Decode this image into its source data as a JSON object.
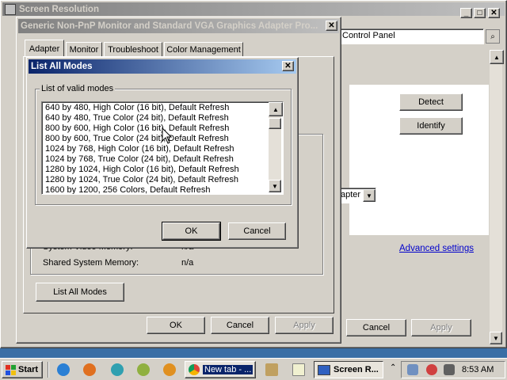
{
  "bg_window": {
    "title": "Screen Resolution",
    "address": "Control Panel",
    "detect_label": "Detect",
    "identify_label": "Identify",
    "dropdown_text": "apter",
    "advanced_link": "Advanced settings",
    "cancel_label": "Cancel",
    "apply_label": "Apply"
  },
  "props_dialog": {
    "title": "Generic Non-PnP Monitor and Standard VGA Graphics Adapter Pro...",
    "tabs": [
      "Adapter",
      "Monitor",
      "Troubleshoot",
      "Color Management"
    ],
    "info_rows": [
      {
        "label": "System Video Memory:",
        "value": "n/a"
      },
      {
        "label": "Shared System Memory:",
        "value": "n/a"
      }
    ],
    "list_all_modes_label": "List All Modes",
    "ok_label": "OK",
    "cancel_label": "Cancel",
    "apply_label": "Apply"
  },
  "modes_dialog": {
    "title": "List All Modes",
    "group_label": "List of valid modes",
    "modes": [
      "640 by 480, High Color (16 bit), Default Refresh",
      "640 by 480, True Color (24 bit), Default Refresh",
      "800 by 600, High Color (16 bit), Default Refresh",
      "800 by 600, True Color (24 bit), Default Refresh",
      "1024 by 768, High Color (16 bit), Default Refresh",
      "1024 by 768, True Color (24 bit), Default Refresh",
      "1280 by 1024, High Color (16 bit), Default Refresh",
      "1280 by 1024, True Color (24 bit), Default Refresh",
      "1600 by 1200, 256 Colors, Default Refresh"
    ],
    "ok_label": "OK",
    "cancel_label": "Cancel"
  },
  "taskbar": {
    "start_label": "Start",
    "tasks": [
      {
        "label": "New tab - ...",
        "icon": "chrome-icon"
      },
      {
        "label": "Screen R...",
        "icon": "display-icon"
      }
    ],
    "clock": "8:53 AM"
  },
  "colors": {
    "title_active": "#0a246a",
    "title_inactive": "#808080",
    "face": "#d4d0c8",
    "desktop": "#3a6ea5"
  }
}
